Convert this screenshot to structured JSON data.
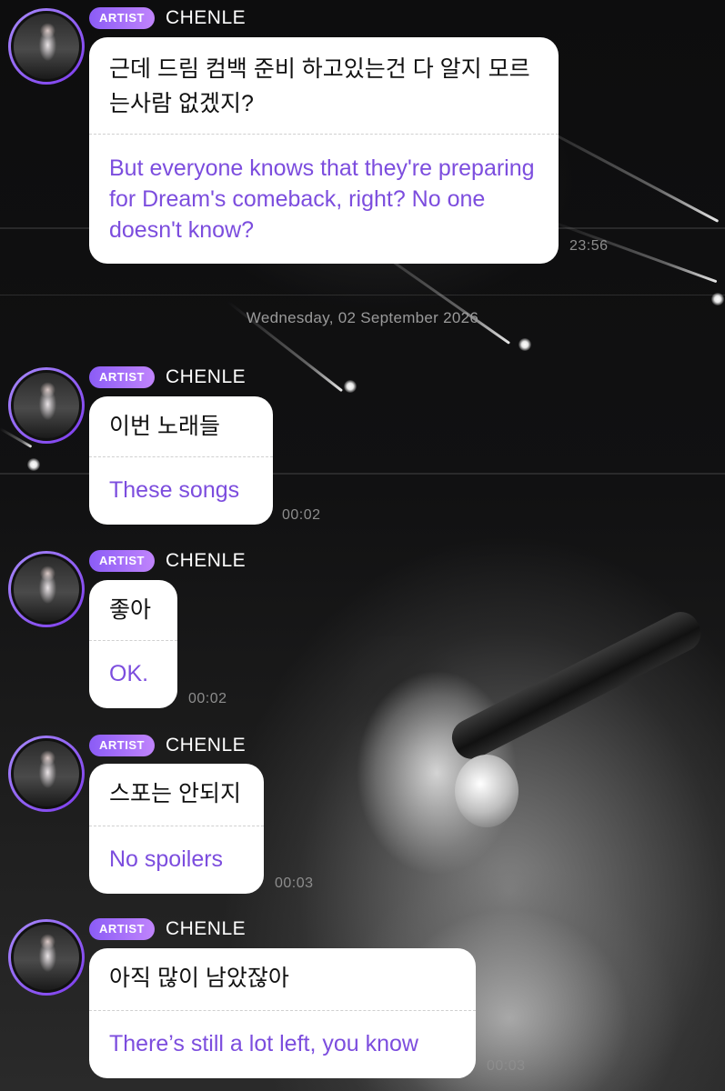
{
  "badge_label": "ARTIST",
  "artist_name": "CHENLE",
  "date_separator": "Wednesday, 02 September 2026",
  "accent_color": "#8b5cf6",
  "translation_color": "#7c4dde",
  "messages": [
    {
      "korean": "근데 드림 컴백 준비 하고있는건 다 알지 모르는사람 없겠지?",
      "english": "But everyone knows that they're preparing for Dream's comeback, right? No one doesn't know?",
      "time": "23:56"
    },
    {
      "korean": "이번 노래들",
      "english": "These songs",
      "time": "00:02"
    },
    {
      "korean": "좋아",
      "english": "OK.",
      "time": "00:02"
    },
    {
      "korean": "스포는 안되지",
      "english": "No spoilers",
      "time": "00:03"
    },
    {
      "korean": "아직 많이 남았잖아",
      "english": "There’s still a lot left, you know",
      "time": "00:03"
    }
  ]
}
